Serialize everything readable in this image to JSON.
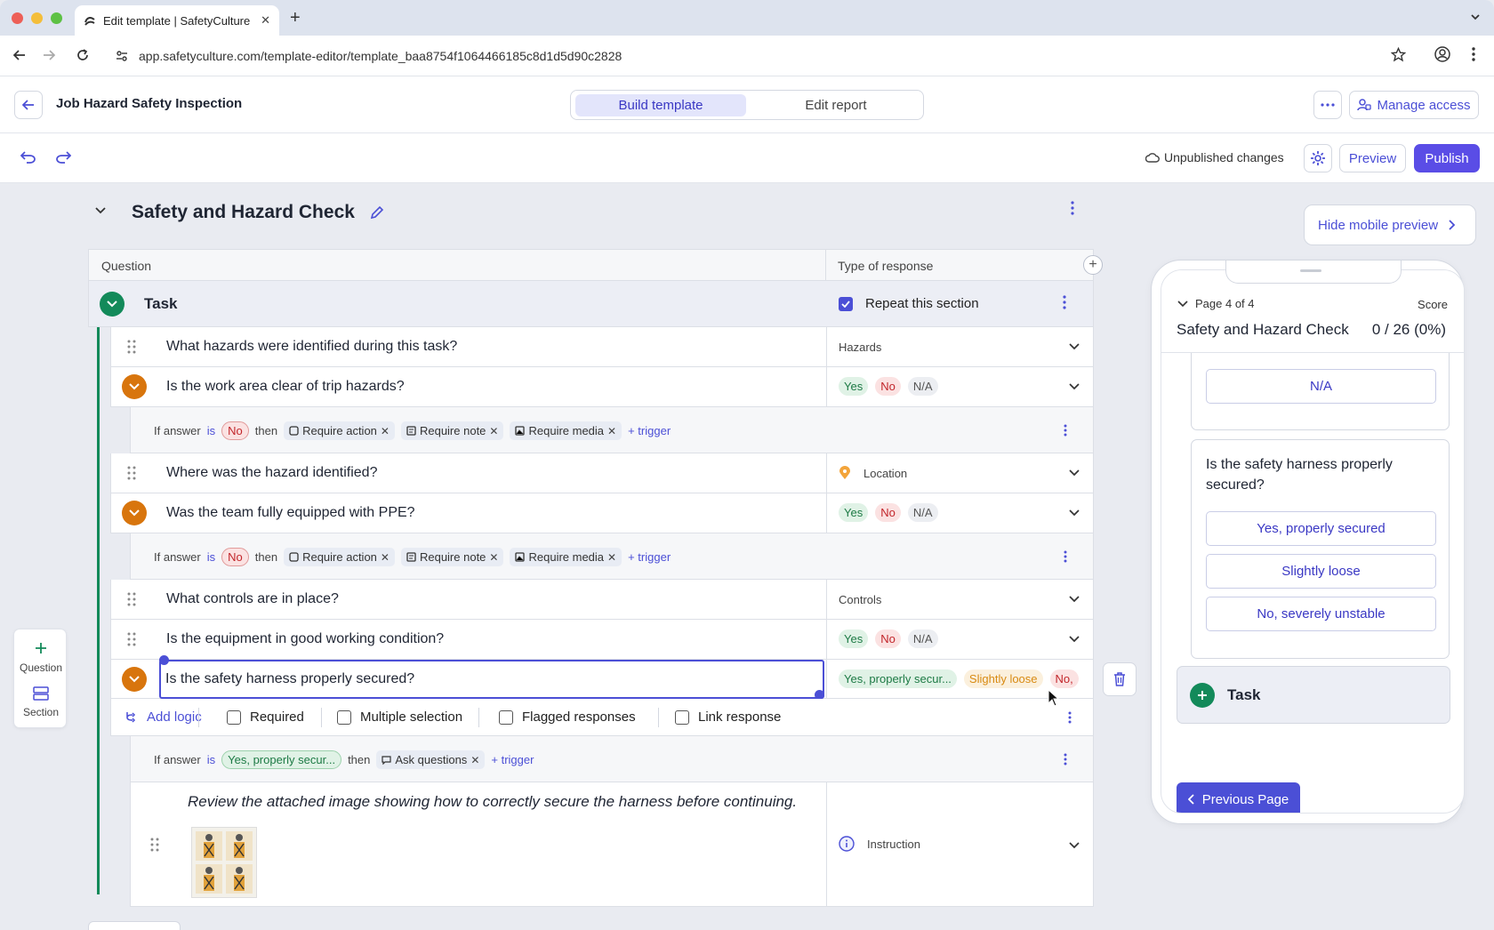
{
  "browser": {
    "tab_title": "Edit template | SafetyCulture",
    "url": "app.safetyculture.com/template-editor/template_baa8754f1064466185c8d1d5d90c2828"
  },
  "header": {
    "template_title": "Job Hazard Safety Inspection",
    "mode_build": "Build template",
    "mode_report": "Edit report",
    "manage_access": "Manage access"
  },
  "toolbar": {
    "status": "Unpublished changes",
    "preview": "Preview",
    "publish": "Publish"
  },
  "section": {
    "title": "Safety and Hazard Check",
    "hide_preview": "Hide mobile preview",
    "col_question": "Question",
    "col_response": "Type of response",
    "task_label": "Task",
    "repeat_label": "Repeat this section"
  },
  "questions": [
    {
      "text": "What hazards were identified during this task?",
      "response": "Hazards"
    },
    {
      "text": "Is the work area clear of trip hazards?",
      "yes": "Yes",
      "no": "No",
      "na": "N/A"
    },
    {
      "text": "Where was the hazard identified?",
      "response": "Location"
    },
    {
      "text": "Was the team fully equipped with PPE?",
      "yes": "Yes",
      "no": "No",
      "na": "N/A"
    },
    {
      "text": "What controls are in place?",
      "response": "Controls"
    },
    {
      "text": "Is the equipment in good working condition?",
      "yes": "Yes",
      "no": "No",
      "na": "N/A"
    },
    {
      "text": "Is the safety harness properly secured?",
      "r1": "Yes, properly secur...",
      "r2": "Slightly loose",
      "r3": "No,"
    }
  ],
  "logic": {
    "if_answer": "If answer",
    "is": "is",
    "then": "then",
    "no": "No",
    "yes_secured": "Yes, properly secur...",
    "require_action": "Require action",
    "require_note": "Require note",
    "require_media": "Require media",
    "ask_questions": "Ask questions",
    "trigger": "+ trigger"
  },
  "options": {
    "add_logic": "Add logic",
    "required": "Required",
    "multiple": "Multiple selection",
    "flagged": "Flagged responses",
    "link": "Link response"
  },
  "instruction": {
    "text": "Review the attached image showing how to correctly secure the harness before continuing.",
    "type": "Instruction"
  },
  "sidebar": {
    "question": "Question",
    "section": "Section"
  },
  "mobile": {
    "page": "Page 4 of 4",
    "score_label": "Score",
    "title": "Safety and Hazard Check",
    "score": "0 / 26 (0%)",
    "na": "N/A",
    "question": "Is the safety harness properly secured?",
    "opt1": "Yes, properly secured",
    "opt2": "Slightly loose",
    "opt3": "No, severely unstable",
    "task": "Task",
    "prev": "Previous Page"
  },
  "colors": {
    "accent": "#4b4fd6",
    "green": "#138a5a",
    "orange": "#d8750d"
  }
}
